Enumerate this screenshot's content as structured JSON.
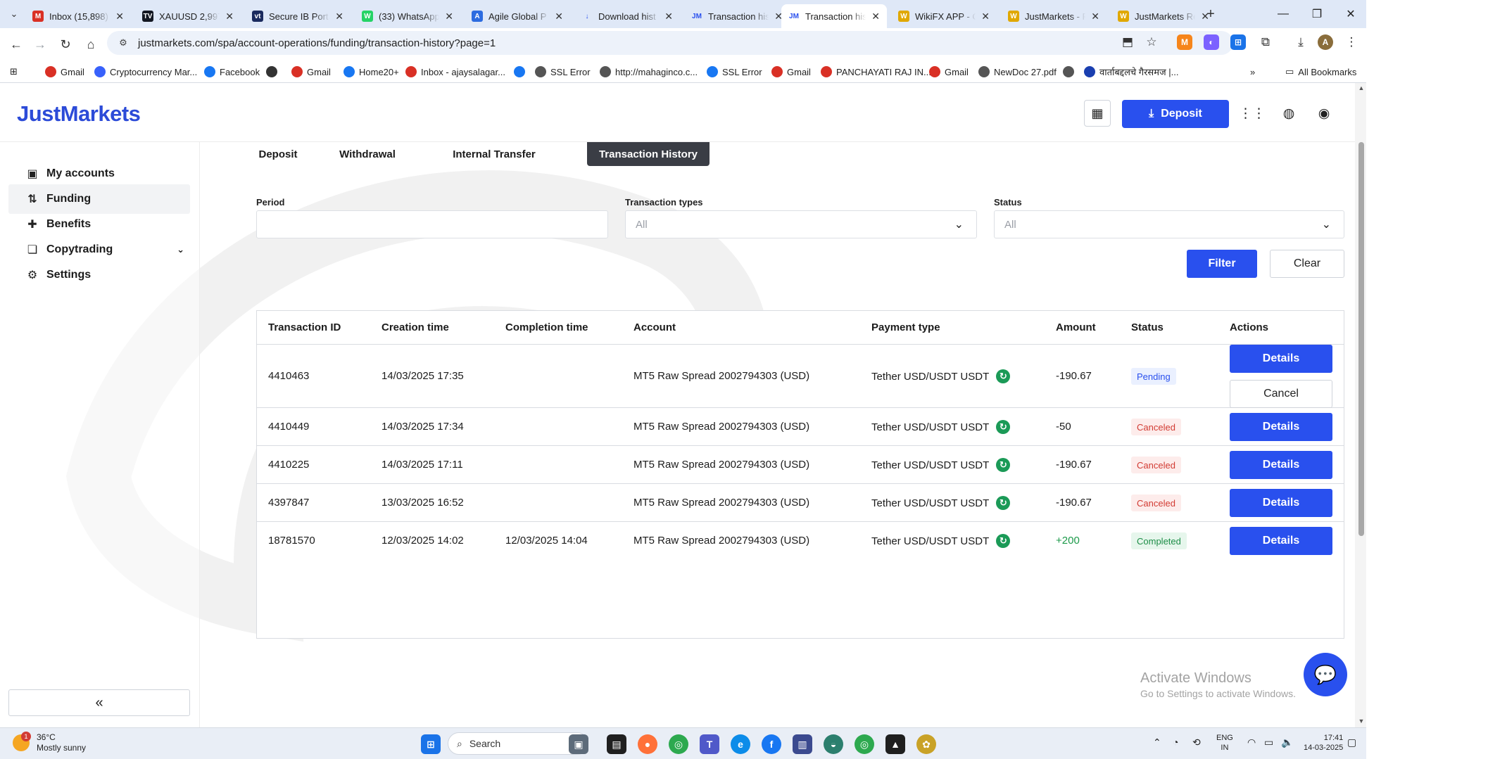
{
  "browser": {
    "tabs": [
      {
        "label": "Inbox (15,898)",
        "icon": "gmail-icon",
        "color": "#d93025",
        "glyph": "M"
      },
      {
        "label": "XAUUSD 2,997",
        "icon": "tradingview-icon",
        "color": "#131722",
        "glyph": "TV"
      },
      {
        "label": "Secure IB Porta",
        "icon": "vt-icon",
        "color": "#1a2a5e",
        "glyph": "vt"
      },
      {
        "label": "(33) WhatsApp",
        "icon": "whatsapp-icon",
        "color": "#25d366",
        "glyph": "W"
      },
      {
        "label": "Agile Global P",
        "icon": "agile-icon",
        "color": "#2c6be0",
        "glyph": "A"
      },
      {
        "label": "Download hist",
        "icon": "download-icon",
        "color": "#2950ee",
        "glyph": "↓"
      },
      {
        "label": "Transaction his",
        "icon": "jm-icon",
        "color": "#2950ee",
        "glyph": "JM"
      },
      {
        "label": "Transaction his",
        "icon": "jm-icon",
        "color": "#2950ee",
        "glyph": "JM"
      },
      {
        "label": "WikiFX APP - C",
        "icon": "wikifx-icon",
        "color": "#e0a800",
        "glyph": "W"
      },
      {
        "label": "JustMarkets - F",
        "icon": "wikifx-icon",
        "color": "#e0a800",
        "glyph": "W"
      },
      {
        "label": "JustMarkets Re",
        "icon": "wikifx-icon",
        "color": "#e0a800",
        "glyph": "W"
      }
    ],
    "active_tab_index": 7,
    "url": "justmarkets.com/spa/account-operations/funding/transaction-history?page=1",
    "bookmarks": [
      {
        "label": "Gmail",
        "icon": "gmail-icon",
        "color": "#d93025"
      },
      {
        "label": "Cryptocurrency Mar...",
        "icon": "coinmarket-icon",
        "color": "#3861fb"
      },
      {
        "label": "Facebook",
        "icon": "facebook-icon",
        "color": "#1877f2"
      },
      {
        "label": "",
        "icon": "bookmark-icon",
        "color": "#333333"
      },
      {
        "label": "Gmail",
        "icon": "gmail-icon",
        "color": "#d93025"
      },
      {
        "label": "Home20+",
        "icon": "facebook-icon",
        "color": "#1877f2"
      },
      {
        "label": "Inbox - ajaysalagar...",
        "icon": "gmail-icon",
        "color": "#d93025"
      },
      {
        "label": "",
        "icon": "facebook-icon",
        "color": "#1877f2"
      },
      {
        "label": "SSL Error",
        "icon": "globe-icon",
        "color": "#555555"
      },
      {
        "label": "http://mahaginco.c...",
        "icon": "globe-icon",
        "color": "#555555"
      },
      {
        "label": "SSL Error",
        "icon": "globe-icon",
        "color": "#1877f2"
      },
      {
        "label": "Gmail",
        "icon": "gmail-icon",
        "color": "#d93025"
      },
      {
        "label": "PANCHAYATI RAJ IN...",
        "icon": "panchayat-icon",
        "color": "#d93025"
      },
      {
        "label": "Gmail",
        "icon": "gmail-icon",
        "color": "#d93025"
      },
      {
        "label": "NewDoc 27.pdf",
        "icon": "globe-icon",
        "color": "#555555"
      },
      {
        "label": "",
        "icon": "globe-icon",
        "color": "#555555"
      },
      {
        "label": "वार्ताबद्दलचे गैरसमज |...",
        "icon": "check-icon",
        "color": "#1a3fb0"
      }
    ],
    "all_bookmarks": "All Bookmarks"
  },
  "header": {
    "logo": "JustMarkets",
    "deposit_label": "Deposit"
  },
  "sidebar": {
    "items": [
      {
        "label": "My accounts",
        "icon": "wallet-icon",
        "active": false
      },
      {
        "label": "Funding",
        "icon": "funding-icon",
        "active": true
      },
      {
        "label": "Benefits",
        "icon": "gift-icon",
        "active": false
      },
      {
        "label": "Copytrading",
        "icon": "copytrading-icon",
        "active": false,
        "expandable": true
      },
      {
        "label": "Settings",
        "icon": "gear-icon",
        "active": false
      }
    ]
  },
  "funding_tabs": [
    {
      "label": "Deposit",
      "active": false
    },
    {
      "label": "Withdrawal",
      "active": false
    },
    {
      "label": "Internal Transfer",
      "active": false
    },
    {
      "label": "Transaction History",
      "active": true
    }
  ],
  "filters": {
    "period_label": "Period",
    "period_value": "",
    "types_label": "Transaction types",
    "types_value": "All",
    "status_label": "Status",
    "status_value": "All",
    "filter_button": "Filter",
    "clear_button": "Clear"
  },
  "table": {
    "columns": [
      "Transaction ID",
      "Creation time",
      "Completion time",
      "Account",
      "Payment type",
      "Amount",
      "Status",
      "Actions"
    ],
    "rows": [
      {
        "id": "4410463",
        "created": "14/03/2025 17:35",
        "completed": "",
        "account": "MT5 Raw Spread 2002794303 (USD)",
        "payment": "Tether USD/USDT USDT",
        "amount": "-190.67",
        "status": "Pending",
        "status_kind": "pending",
        "actions": [
          "Details",
          "Cancel"
        ]
      },
      {
        "id": "4410449",
        "created": "14/03/2025 17:34",
        "completed": "",
        "account": "MT5 Raw Spread 2002794303 (USD)",
        "payment": "Tether USD/USDT USDT",
        "amount": "-50",
        "status": "Canceled",
        "status_kind": "canceled",
        "actions": [
          "Details"
        ]
      },
      {
        "id": "4410225",
        "created": "14/03/2025 17:11",
        "completed": "",
        "account": "MT5 Raw Spread 2002794303 (USD)",
        "payment": "Tether USD/USDT USDT",
        "amount": "-190.67",
        "status": "Canceled",
        "status_kind": "canceled",
        "actions": [
          "Details"
        ]
      },
      {
        "id": "4397847",
        "created": "13/03/2025 16:52",
        "completed": "",
        "account": "MT5 Raw Spread 2002794303 (USD)",
        "payment": "Tether USD/USDT USDT",
        "amount": "-190.67",
        "status": "Canceled",
        "status_kind": "canceled",
        "actions": [
          "Details"
        ]
      },
      {
        "id": "18781570",
        "created": "12/03/2025 14:02",
        "completed": "12/03/2025 14:04",
        "account": "MT5 Raw Spread 2002794303 (USD)",
        "payment": "Tether USD/USDT USDT",
        "amount": "+200",
        "status": "Completed",
        "status_kind": "completed",
        "actions": [
          "Details"
        ]
      }
    ]
  },
  "activate_windows": {
    "title": "Activate Windows",
    "subtitle": "Go to Settings to activate Windows."
  },
  "taskbar": {
    "weather_temp": "36°C",
    "weather_desc": "Mostly sunny",
    "weather_alert": "1",
    "search_placeholder": "Search",
    "lang_top": "ENG",
    "lang_bottom": "IN",
    "time": "17:41",
    "date": "14-03-2025"
  },
  "colors": {
    "accent": "#2950ee",
    "logo": "#2c4bd8",
    "pending": "#2950ee",
    "canceled": "#d23b33",
    "completed": "#1c8d46"
  }
}
